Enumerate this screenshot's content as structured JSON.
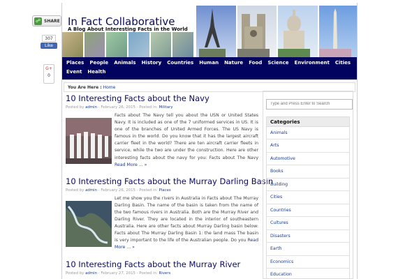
{
  "share": {
    "label": "SHARE",
    "facebook_count": "307",
    "facebook_like": "Like",
    "gplus_label": "G+",
    "gplus_count": "0"
  },
  "site": {
    "title": "In Fact Collaborative",
    "tagline": "A Blog About Interesting Facts in the World"
  },
  "nav": {
    "items": [
      "Places",
      "People",
      "Animals",
      "History",
      "Countries",
      "Human",
      "Nature",
      "Food",
      "Science",
      "Environment",
      "Cities",
      "Event",
      "Health"
    ]
  },
  "breadcrumb": {
    "label": "You Are Here :",
    "home": "Home"
  },
  "posts": [
    {
      "title": "10 Interesting Facts about the Navy",
      "meta_prefix": "Posted by",
      "author": "admin",
      "date": "- February 26, 2015 - Posted in:",
      "category": "Military",
      "excerpt": "Facts about The Navy tell you about the USN or United States Navy. It is included as one of the 7 uniformed services in US. It is one of the branches of United Armed Forces. The US Navy is famous in the world. Do you know that it has the largest aircraft carrier fleet in the world? There are ten aircraft carrier fleets in service, while the two are under the construction. Here are other interesting facts about the navy for you: Facts about The Navy",
      "more": "Read More ... »"
    },
    {
      "title": "10 Interesting Facts about the Murray Darling Basin",
      "meta_prefix": "Posted by",
      "author": "admin",
      "date": "- February 26, 2015 - Posted in:",
      "category": "Places",
      "excerpt": "Let me show you the rivers in Australia in Facts about The Murray Darling Basin. The name of the basin is taken from the name of the two famous rivers in Australia. Both are the Murray River and Darling River. They are located in the interior of southeastern Australia. Here are other facts about Murray Darling basin below: Facts about The Murray Darling Basin 1: the land mass The basin is very important to the life of the Australian people. Do you",
      "more": "Read More ... »"
    },
    {
      "title": "10 Interesting Facts about the Murray River",
      "meta_prefix": "Posted by",
      "author": "admin",
      "date": "- February 27, 2015 - Posted in:",
      "category": "Rivers"
    }
  ],
  "sidebar": {
    "search_placeholder": "Type and Press Enter to Search",
    "categories_title": "Categories",
    "categories": [
      "Animals",
      "Arts",
      "Automotive",
      "Books",
      "Building",
      "Cities",
      "Countries",
      "Cultures",
      "Disasters",
      "Earth",
      "Economics",
      "Education"
    ]
  },
  "colors": {
    "nav_bg": "#02035e",
    "title": "#0a0a66",
    "link": "#1c3b8c"
  }
}
